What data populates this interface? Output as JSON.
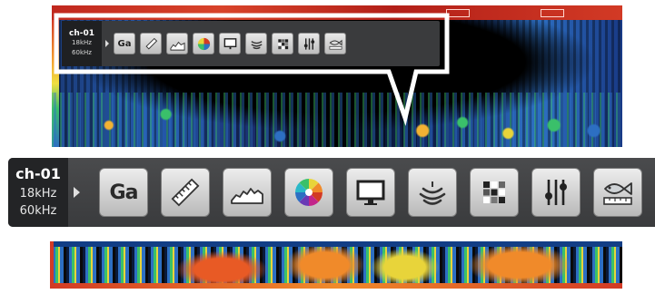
{
  "channel": {
    "name": "ch-01",
    "freq_low": "18kHz",
    "freq_high": "60kHz"
  },
  "menu": {
    "gain_label": "Ga",
    "buttons": [
      {
        "id": "gain",
        "icon": "gain-text-icon"
      },
      {
        "id": "ruler",
        "icon": "ruler-icon"
      },
      {
        "id": "bottom-profile",
        "icon": "seabed-profile-icon"
      },
      {
        "id": "color",
        "icon": "color-wheel-icon"
      },
      {
        "id": "display",
        "icon": "monitor-icon"
      },
      {
        "id": "sonar",
        "icon": "sonar-waves-icon"
      },
      {
        "id": "pixel",
        "icon": "grid-icon"
      },
      {
        "id": "adjust",
        "icon": "sliders-icon"
      },
      {
        "id": "fish-size",
        "icon": "fish-ruler-icon"
      }
    ]
  },
  "colors": {
    "menu_bg": "#3a3b3d",
    "channel_bg": "#232426",
    "button_face": "#d6d6d6",
    "callout_outline": "#ffffff"
  }
}
